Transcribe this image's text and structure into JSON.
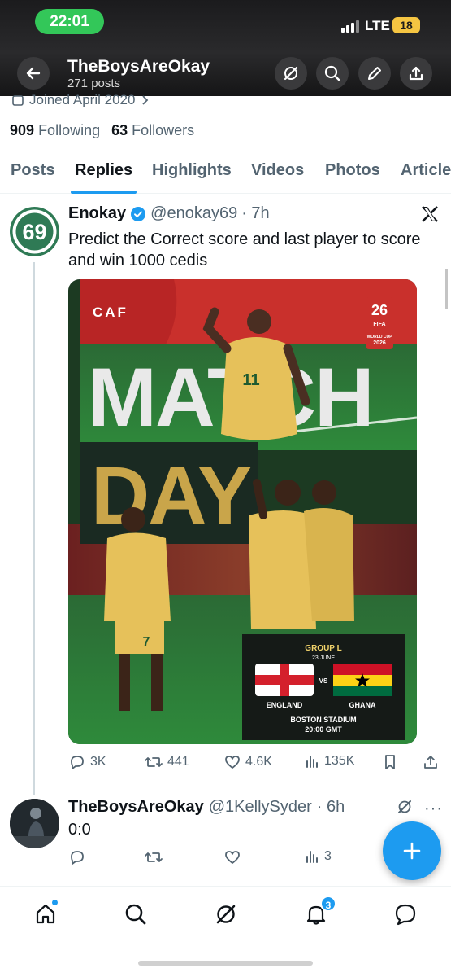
{
  "status_bar": {
    "time": "22:01",
    "network": "LTE",
    "battery": "18"
  },
  "header": {
    "title": "TheBoysAreOkay",
    "subtitle": "271 posts"
  },
  "profile": {
    "joined": "Joined April 2020",
    "following_count": "909",
    "following_label": "Following",
    "followers_count": "63",
    "followers_label": "Followers"
  },
  "tabs": [
    "Posts",
    "Replies",
    "Highlights",
    "Videos",
    "Photos",
    "Articles"
  ],
  "active_tab": "Replies",
  "tweet1": {
    "avatar_text": "69",
    "name": "Enokay",
    "handle": "@enokay69",
    "time": "· 7h",
    "text": "Predict the Correct score and last player to score and win 1000 cedis",
    "media": {
      "caf": "CAF",
      "word1": "MATCH",
      "word2": "DAY",
      "badge_number": "26",
      "badge_fifa": "FIFA",
      "badge_text": "WORLD CUP",
      "badge_year": "2026",
      "jersey1": "11",
      "jersey2": "7",
      "group": "GROUP L",
      "date": "23 JUNE",
      "team_home": "ENGLAND",
      "team_away": "GHANA",
      "vs": "VS",
      "venue": "BOSTON STADIUM",
      "kickoff": "20:00 GMT"
    },
    "actions": {
      "replies": "3K",
      "reposts": "441",
      "likes": "4.6K",
      "views": "135K"
    }
  },
  "tweet2": {
    "name": "TheBoysAreOkay",
    "handle": "@1KellySyder",
    "time": "· 6h",
    "more": "···",
    "text": "0:0",
    "actions": {
      "views": "3"
    }
  },
  "bottom_nav": {
    "notifications_badge": "3"
  },
  "colors": {
    "accent": "#1d9bf0",
    "status_green": "#33c759",
    "battery": "#f5c542",
    "ghana_gold": "#e6c15a",
    "ghana_green": "#1e7a3c"
  }
}
